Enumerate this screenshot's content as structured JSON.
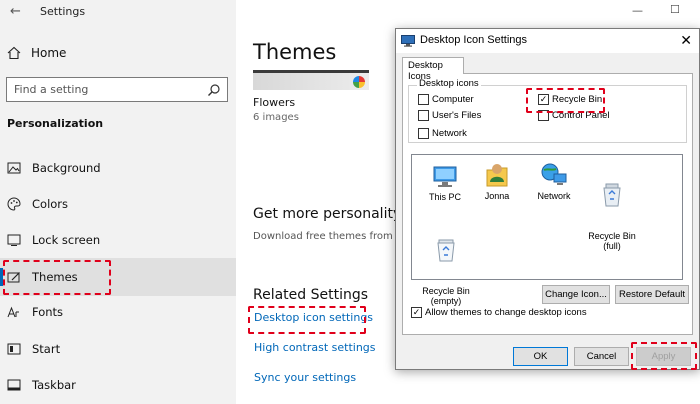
{
  "settings": {
    "app_title": "Settings",
    "back_label": "←",
    "home_label": "Home",
    "search_placeholder": "Find a setting",
    "section_title": "Personalization",
    "nav_items": [
      {
        "label": "Background",
        "icon": "picture-icon"
      },
      {
        "label": "Colors",
        "icon": "palette-icon"
      },
      {
        "label": "Lock screen",
        "icon": "lock-screen-icon"
      },
      {
        "label": "Themes",
        "icon": "themes-icon",
        "selected": true
      },
      {
        "label": "Fonts",
        "icon": "fonts-icon"
      },
      {
        "label": "Start",
        "icon": "start-icon"
      },
      {
        "label": "Taskbar",
        "icon": "taskbar-icon"
      }
    ],
    "window_controls": {
      "minimize": "—",
      "maximize": "☐"
    }
  },
  "main": {
    "title": "Themes",
    "current_theme": {
      "name": "Flowers",
      "count": "6 images"
    },
    "get_more_title": "Get more personality",
    "get_more_desc": "Download free themes from th",
    "related_title": "Related Settings",
    "links": [
      "Desktop icon settings",
      "High contrast settings",
      "Sync your settings"
    ]
  },
  "dialog": {
    "title": "Desktop Icon Settings",
    "close_label": "✕",
    "tab_label": "Desktop Icons",
    "group_label": "Desktop icons",
    "checkboxes": [
      {
        "label": "Computer",
        "checked": false
      },
      {
        "label": "User's Files",
        "checked": false
      },
      {
        "label": "Network",
        "checked": false
      },
      {
        "label": "Recycle Bin",
        "checked": true
      },
      {
        "label": "Control Panel",
        "checked": false
      }
    ],
    "icons": [
      {
        "label": "This PC",
        "icon": "this-pc-icon"
      },
      {
        "label": "Jonna",
        "icon": "user-folder-icon"
      },
      {
        "label": "Network",
        "icon": "network-icon"
      },
      {
        "label": "Recycle Bin\n(full)",
        "icon": "recycle-bin-full-icon"
      },
      {
        "label": "Recycle Bin\n(empty)",
        "icon": "recycle-bin-empty-icon"
      }
    ],
    "change_icon_label": "Change Icon...",
    "restore_default_label": "Restore Default",
    "allow_themes_label": "Allow themes to change desktop icons",
    "allow_themes_checked": true,
    "ok_label": "OK",
    "cancel_label": "Cancel",
    "apply_label": "Apply",
    "check_mark": "✓"
  },
  "colors": {
    "accent": "#0067b8",
    "highlight": "#e0001b"
  }
}
